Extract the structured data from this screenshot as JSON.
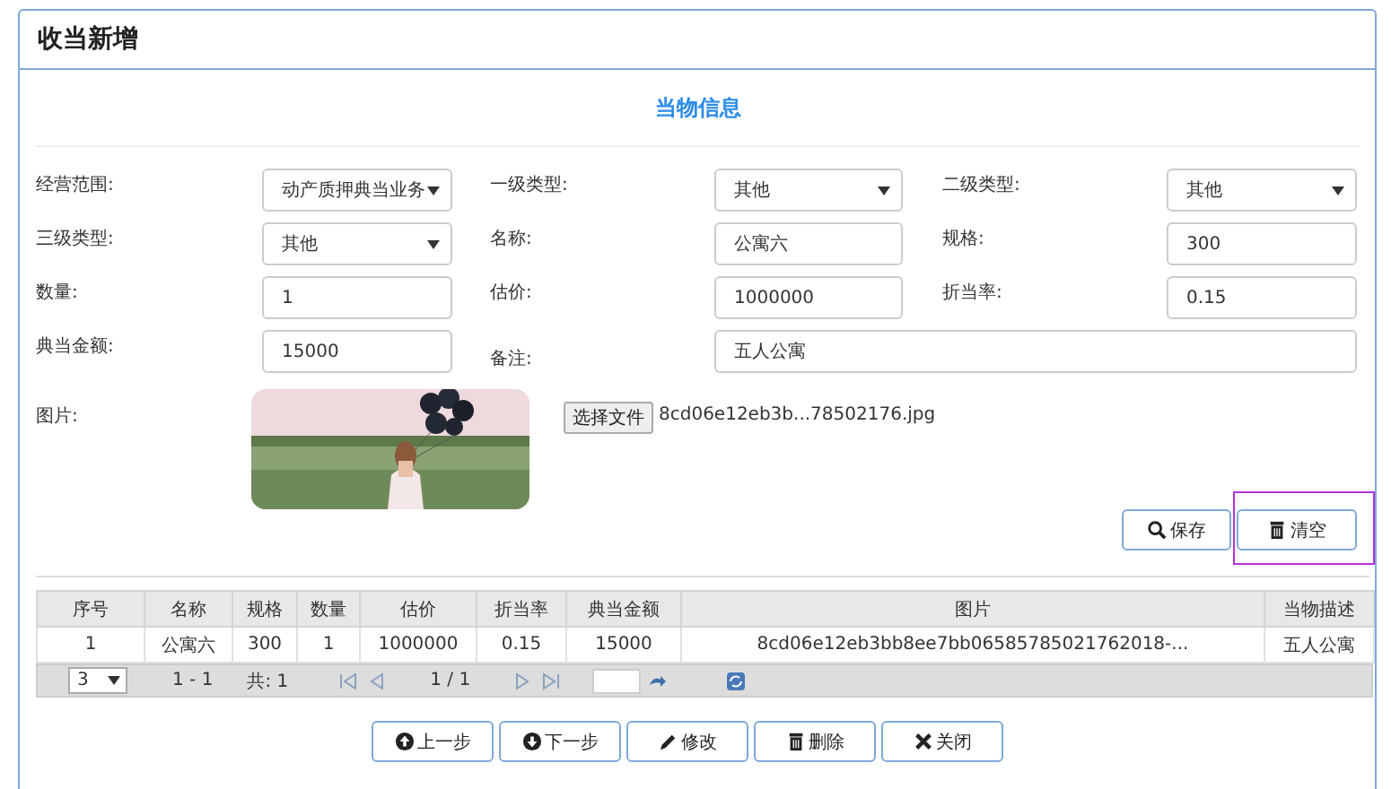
{
  "panel": {
    "title": "收当新增"
  },
  "section_title": "当物信息",
  "fields": [
    {
      "label": "经营范围:",
      "kind": "select",
      "value": "动产质押典当业务"
    },
    {
      "label": "一级类型:",
      "kind": "select",
      "value": "其他"
    },
    {
      "label": "二级类型:",
      "kind": "select",
      "value": "其他"
    },
    {
      "label": "三级类型:",
      "kind": "select",
      "value": "其他"
    },
    {
      "label": "名称:",
      "kind": "text",
      "value": "公寓六"
    },
    {
      "label": "规格:",
      "kind": "text",
      "value": "300"
    },
    {
      "label": "数量:",
      "kind": "text",
      "value": "1"
    },
    {
      "label": "估价:",
      "kind": "text",
      "value": "1000000"
    },
    {
      "label": "折当率:",
      "kind": "text",
      "value": "0.15"
    },
    {
      "label": "典当金额:",
      "kind": "text",
      "value": "15000"
    },
    {
      "label": "备注:",
      "kind": "wide",
      "value": "五人公寓"
    }
  ],
  "picture_field": {
    "label": "图片:",
    "file_button": "选择文件",
    "file_name": "8cd06e12eb3b...78502176.jpg"
  },
  "form_buttons": [
    {
      "kind": "search",
      "label": "保存",
      "highlighted": false
    },
    {
      "kind": "trash",
      "label": "清空",
      "highlighted": true
    }
  ],
  "table": {
    "columns": [
      "序号",
      "名称",
      "规格",
      "数量",
      "估价",
      "折当率",
      "典当金额",
      "图片",
      "当物描述"
    ],
    "rows": [
      [
        "1",
        "公寓六",
        "300",
        "1",
        "1000000",
        "0.15",
        "15000",
        "8cd06e12eb3bb8ee7bb06585785021762018-...",
        "五人公寓"
      ]
    ]
  },
  "pager": {
    "page_size": "3",
    "range": "1 - 1",
    "total": "共: 1",
    "page": "1 / 1"
  },
  "actions": [
    {
      "kind": "up",
      "label": "上一步"
    },
    {
      "kind": "down",
      "label": "下一步"
    },
    {
      "kind": "pencil",
      "label": "修改"
    },
    {
      "kind": "trash",
      "label": "删除"
    },
    {
      "kind": "close",
      "label": "关闭"
    }
  ]
}
